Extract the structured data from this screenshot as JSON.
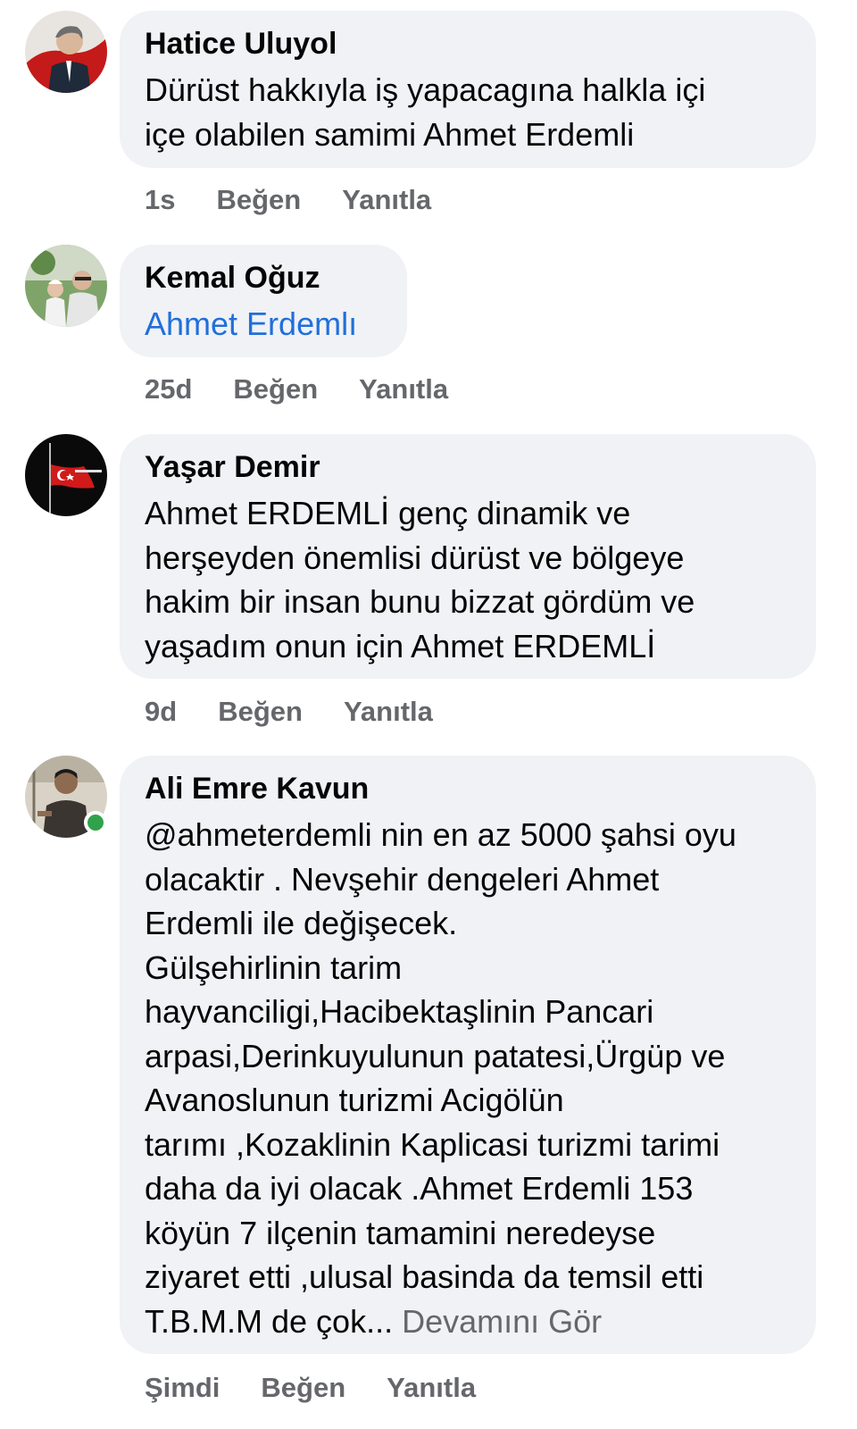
{
  "comments": [
    {
      "author": "Hatice Uluyol",
      "text": "Dürüst hakkıyla iş yapacagına halkla içi\niçe olabilen samimi Ahmet Erdemli",
      "time": "1s",
      "like_label": "Beğen",
      "reply_label": "Yanıtla"
    },
    {
      "author": "Kemal Oğuz",
      "mention": "Ahmet Erdemlı",
      "time": "25d",
      "like_label": "Beğen",
      "reply_label": "Yanıtla"
    },
    {
      "author": "Yaşar Demir",
      "text": "Ahmet ERDEMLİ genç dinamik ve\nherşeyden önemlisi dürüst ve bölgeye\nhakim bir insan bunu bizzat gördüm ve\nyaşadım onun için Ahmet ERDEMLİ",
      "time": "9d",
      "like_label": "Beğen",
      "reply_label": "Yanıtla"
    },
    {
      "author": "Ali Emre Kavun",
      "text": "@ahmeterdemli nin en az 5000 şahsi oyu\nolacaktir . Nevşehir dengeleri Ahmet\nErdemli ile değişecek.\nGülşehirlinin tarim\nhayvanciligi,Hacibektaşlinin Pancari\narpasi,Derinkuyulunun patatesi,Ürgüp ve\nAvanoslunun turizmi Acigölün\ntarımı ,Kozaklinin Kaplicasi turizmi tarimi\ndaha da iyi olacak .Ahmet Erdemli 153\nköyün 7 ilçenin tamamini neredeyse\nziyaret etti ,ulusal basinda da temsil etti\nT.B.M.M de çok...",
      "see_more": "Devamını Gör",
      "time": "Şimdi",
      "like_label": "Beğen",
      "reply_label": "Yanıtla",
      "online": true
    }
  ],
  "colors": {
    "bubble": "#f0f2f5",
    "link": "#216fdb",
    "meta": "#65676b",
    "online": "#31a24c"
  }
}
